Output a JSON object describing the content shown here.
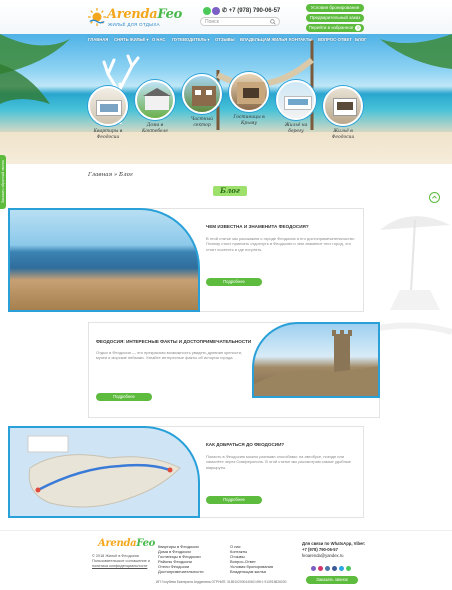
{
  "header": {
    "logo_main": "Arenda",
    "logo_accent": "Feo",
    "logo_sub": "Жильё для отдыха",
    "phone": "+7 (978) 790-06-57",
    "search_placeholder": "Поиск",
    "btn_housing": "Условия бронирования",
    "btn_owners": "Предварительный заказ",
    "btn_favorites": "Перейти в избранное",
    "favorites_count": "0"
  },
  "nav": [
    "Главная",
    "Снять жильё ▾",
    "О нас",
    "Путеводитель ▾",
    "Отзывы",
    "Владельцам жилья",
    "Контакты",
    "Вопрос-ответ",
    "Блог"
  ],
  "categories": [
    {
      "label_1": "Квартиры в",
      "label_2": "Феодосии"
    },
    {
      "label_1": "Дома в",
      "label_2": "Коктебеле"
    },
    {
      "label_1": "Частный",
      "label_2": "сектор"
    },
    {
      "label_1": "Гостиницы в",
      "label_2": "Крыму"
    },
    {
      "label_1": "Жильё на",
      "label_2": "берегу"
    },
    {
      "label_1": "Жильё в",
      "label_2": "Феодосии"
    }
  ],
  "breadcrumb": "Главная » Блог",
  "page_title": "Блог",
  "side_tab": "Заказать обратный звонок",
  "articles": [
    {
      "title": "Чем известна и знаменита Феодосия?",
      "text": "В этой статье мы расскажем о городе Феодосия и его достопримечательностях. Почему стоит приехать отдохнуть в Феодосию и чем знаменит этот город, что стоит посетить и где погулять.",
      "button": "Подробнее"
    },
    {
      "title": "Феодосия: интересные факты и достопримечательности",
      "text": "Отдых в Феодосии — это прекрасная возможность увидеть древние крепости, музеи и морские пейзажи. Узнайте интересные факты об истории города.",
      "button": "Подробнее"
    },
    {
      "title": "Как добраться до Феодосии?",
      "text": "Попасть в Феодосию можно разными способами: на автобусе, поезде или самолёте через Симферополь. В этой статье мы рассмотрим самые удобные маршруты.",
      "button": "Подробнее"
    }
  ],
  "footer": {
    "logo_main": "Arenda",
    "logo_accent": "Feo",
    "about_1": "© 2018 Жильё в Феодосии",
    "about_2": "Пользовательское соглашение и",
    "about_3": "политика конфиденциальности",
    "col1": [
      "Квартиры в Феодосии",
      "Дома в Феодосии",
      "Гостиницы в Феодосии",
      "Районы Феодосии",
      "Отели Феодосии",
      "Достопримечательности"
    ],
    "col2": [
      "О нас",
      "Контакты",
      "Отзывы",
      "Вопрос-Ответ",
      "Условия бронирования",
      "Владельцам жилья"
    ],
    "contact_title": "Для связи по WhatsApp, Viber:",
    "contact_phone": "+7 (978) 790-06-57",
    "contact_email": "feoarenda@yandex.ru",
    "button": "Заказать звонок",
    "copyright": "ИП Голубева Екатерина Андреевна ОГРНИП: 318910200044060 ИНН: 910915826030"
  },
  "colors": {
    "green": "#5dbb3d",
    "blue": "#29a0d8"
  }
}
